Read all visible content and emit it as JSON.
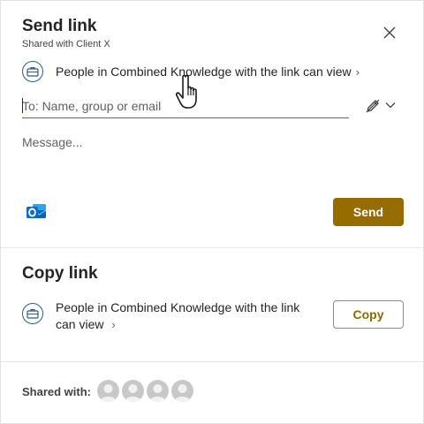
{
  "send_link": {
    "title": "Send link",
    "subtitle": "Shared with Client X",
    "permission_text": "People in Combined Knowledge with the link can view",
    "permission_chevron": "›",
    "to_placeholder": "To: Name, group or email",
    "message_placeholder": "Message...",
    "send_label": "Send"
  },
  "copy_link": {
    "title": "Copy link",
    "permission_text": "People in Combined Knowledge with the link can view",
    "permission_chevron": "›",
    "copy_label": "Copy"
  },
  "footer": {
    "shared_with_label": "Shared with:",
    "avatars": [
      "avatar",
      "avatar",
      "avatar",
      "avatar"
    ]
  },
  "colors": {
    "accent": "#966b00",
    "icon_blue": "#2b5c8a",
    "outlook_blue": "#0f6cbd"
  },
  "icons": {
    "close": "close-icon",
    "permission": "briefcase-icon",
    "pen": "pen-icon",
    "outlook": "outlook-icon",
    "cursor": "hand-cursor-icon"
  }
}
